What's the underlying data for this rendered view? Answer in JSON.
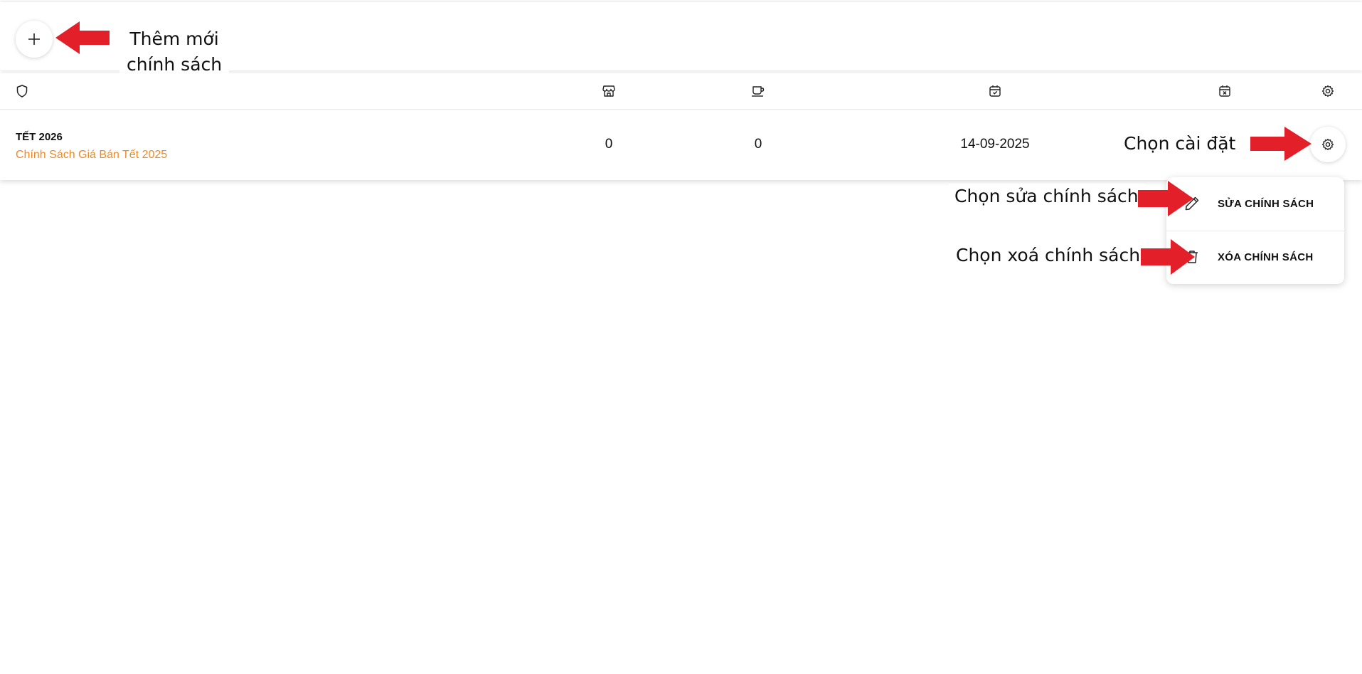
{
  "toolbar": {
    "add_icon": "plus-icon"
  },
  "annotations": {
    "add_line1": "Thêm mới",
    "add_line2": "chính sách",
    "settings": "Chọn cài đặt",
    "edit": "Chọn sửa chính sách",
    "delete": "Chọn xoá chính sách"
  },
  "table": {
    "header_icons": [
      "shield-icon",
      "store-icon",
      "coffee-cup-icon",
      "calendar-check-icon",
      "calendar-x-icon",
      "gear-icon"
    ],
    "rows": [
      {
        "title": "TẾT 2026",
        "subtitle": "Chính Sách Giá Bán Tết 2025",
        "stores": "0",
        "products": "0",
        "start_date": "14-09-2025",
        "end_date": ""
      }
    ]
  },
  "menu": {
    "edit_label": "SỬA CHÍNH SÁCH",
    "delete_label": "XÓA CHÍNH SÁCH"
  },
  "colors": {
    "accent_orange": "#f08a24",
    "annotation_arrow": "#e3202a"
  }
}
